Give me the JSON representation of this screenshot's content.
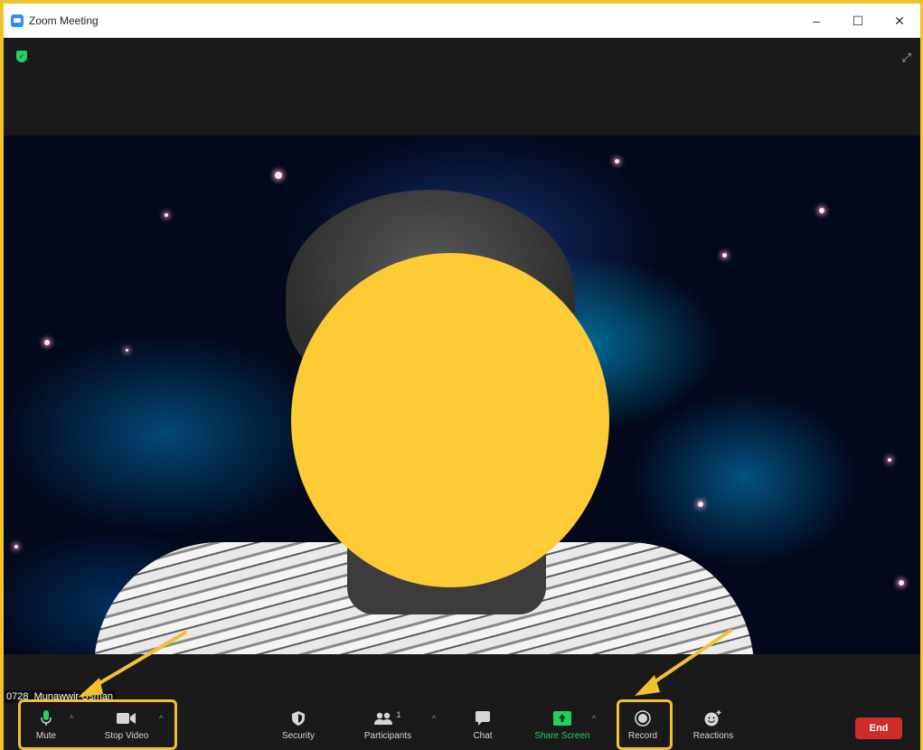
{
  "window": {
    "title": "Zoom Meeting",
    "minimize": "–",
    "maximize": "☐",
    "close": "✕"
  },
  "video": {
    "participant_name": "0728_Munawwir Usman"
  },
  "toolbar": {
    "mute_label": "Mute",
    "stop_video_label": "Stop Video",
    "security_label": "Security",
    "participants_label": "Participants",
    "participants_count": "1",
    "chat_label": "Chat",
    "share_screen_label": "Share Screen",
    "record_label": "Record",
    "reactions_label": "Reactions",
    "end_label": "End"
  },
  "colors": {
    "highlight": "#f2c12e",
    "share_green": "#23d160",
    "end_red": "#d02c2c",
    "face_mask": "#fccb36"
  },
  "icons": {
    "mic": "microphone-icon",
    "camera": "video-camera-icon",
    "security": "shield-icon",
    "participants": "people-icon",
    "chat": "chat-bubble-icon",
    "share": "share-screen-icon",
    "record": "record-icon",
    "reactions": "smiley-plus-icon"
  }
}
